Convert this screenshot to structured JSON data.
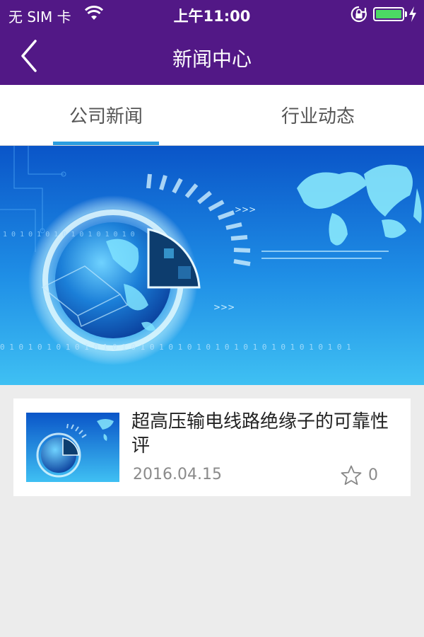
{
  "status_bar": {
    "carrier": "无 SIM 卡",
    "time": "上午11:00",
    "icons": [
      "wifi-icon",
      "orientation-lock-icon",
      "battery-icon",
      "charging-icon"
    ]
  },
  "nav": {
    "title": "新闻中心",
    "back_icon": "chevron-left-icon"
  },
  "tabs": [
    {
      "label": "公司新闻",
      "active": true
    },
    {
      "label": "行业动态",
      "active": false
    }
  ],
  "banner": {
    "binary_text_top": "1 0 1 0 1 0 1 0 1 0 1 0 1 0 1 0",
    "binary_text_bottom": "0 1 0 1 0 1 0 1 0 1 0 1 0 1 0 1 0 1 0 1 0 1 0 1 0 1 0 1 0 1 0 1 0 1 0 1 0 1"
  },
  "news": [
    {
      "title": "超高压输电线路绝缘子的可靠性评",
      "date": "2016.04.15",
      "favorites": "0"
    }
  ],
  "colors": {
    "nav_bg": "#521886",
    "tab_indicator": "#2b9de0",
    "page_bg": "#ececec",
    "battery": "#4cd964"
  }
}
